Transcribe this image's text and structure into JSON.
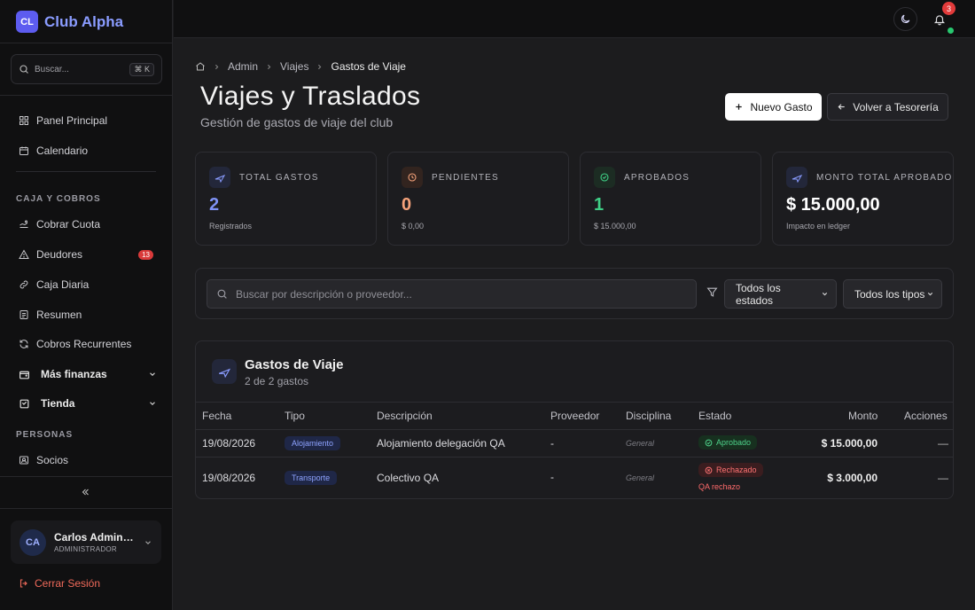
{
  "sidebar": {
    "brand_badge": "CL",
    "brand_name": "Club Alpha",
    "search_placeholder": "Buscar...",
    "search_shortcut": "⌘ K",
    "nav": [
      {
        "label": "Panel Principal"
      },
      {
        "label": "Calendario"
      }
    ],
    "section_caja": "CAJA Y COBROS",
    "caja_items": [
      {
        "label": "Cobrar Cuota"
      },
      {
        "label": "Deudores",
        "badge": "13"
      },
      {
        "label": "Caja Diaria"
      },
      {
        "label": "Resumen"
      },
      {
        "label": "Cobros Recurrentes"
      }
    ],
    "groups": [
      {
        "label": "Más finanzas"
      },
      {
        "label": "Tienda"
      }
    ],
    "section_personas": "PERSONAS",
    "personas_items": [
      {
        "label": "Socios"
      }
    ],
    "user": {
      "initials": "CA",
      "name": "Carlos Administrador",
      "role": "ADMINISTRADOR"
    },
    "logout_label": "Cerrar Sesión"
  },
  "topbar": {
    "notification_count": "3"
  },
  "breadcrumb": {
    "items": [
      "Admin",
      "Viajes",
      "Gastos de Viaje"
    ]
  },
  "page": {
    "title": "Viajes y Traslados",
    "subtitle": "Gestión de gastos de viaje del club",
    "new_button": "Nuevo Gasto",
    "back_button": "Volver a Tesorería"
  },
  "stats": [
    {
      "label": "TOTAL GASTOS",
      "value": "2",
      "sub": "Registrados",
      "color": "#7f92f5"
    },
    {
      "label": "PENDIENTES",
      "value": "0",
      "sub": "$ 0,00",
      "color": "#f5a27a"
    },
    {
      "label": "APROBADOS",
      "value": "1",
      "sub": "$ 15.000,00",
      "color": "#3fcf86"
    },
    {
      "label": "MONTO TOTAL APROBADO",
      "value": "$ 15.000,00",
      "sub": "Impacto en ledger",
      "color": "#ffffff"
    }
  ],
  "filters": {
    "search_placeholder": "Buscar por descripción o proveedor...",
    "status_select": "Todos los estados",
    "type_select": "Todos los tipos"
  },
  "table": {
    "title": "Gastos de Viaje",
    "subtitle": "2 de 2 gastos",
    "headers": [
      "Fecha",
      "Tipo",
      "Descripción",
      "Proveedor",
      "Disciplina",
      "Estado",
      "Monto",
      "Acciones"
    ],
    "rows": [
      {
        "fecha": "19/08/2026",
        "tipo": "Alojamiento",
        "descripcion": "Alojamiento delegación QA",
        "proveedor": "-",
        "disciplina": "General",
        "estado": "Aprobado",
        "motivo": "",
        "monto": "$ 15.000,00",
        "acciones": "—"
      },
      {
        "fecha": "19/08/2026",
        "tipo": "Transporte",
        "descripcion": "Colectivo QA",
        "proveedor": "-",
        "disciplina": "General",
        "estado": "Rechazado",
        "motivo": "QA rechazo",
        "monto": "$ 3.000,00",
        "acciones": "—"
      }
    ]
  }
}
